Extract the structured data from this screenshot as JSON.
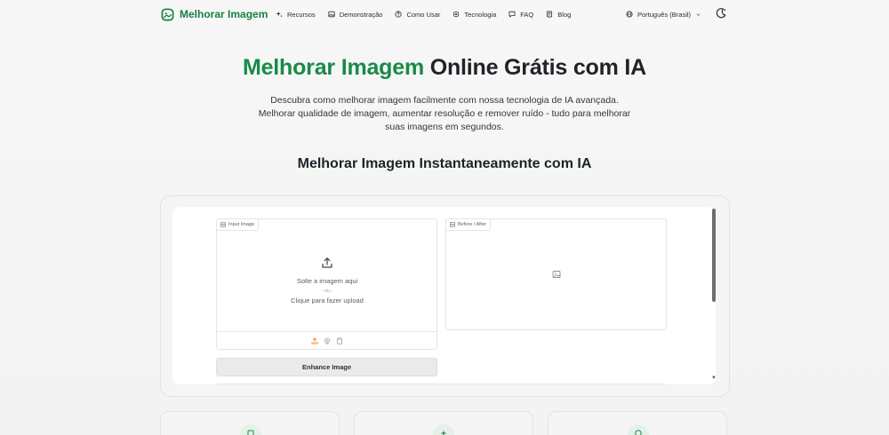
{
  "brand": {
    "name": "Melhorar Imagem",
    "color": "#1a7f43"
  },
  "nav": {
    "items": [
      {
        "label": "Recursos",
        "icon": "sparkles-icon"
      },
      {
        "label": "Demonstração",
        "icon": "image-icon"
      },
      {
        "label": "Como Usar",
        "icon": "help-circle-icon"
      },
      {
        "label": "Tecnologia",
        "icon": "chip-icon"
      },
      {
        "label": "FAQ",
        "icon": "message-question-icon"
      },
      {
        "label": "Blog",
        "icon": "book-icon"
      }
    ],
    "language": "Português (Brasil)"
  },
  "hero": {
    "title_highlight": "Melhorar Imagem",
    "title_rest": " Online Grátis com IA",
    "subtitle": "Descubra como melhorar imagem facilmente com nossa tecnologia de IA avançada. Melhorar qualidade de imagem, aumentar resolução e remover ruído - tudo para melhorar suas imagens em segundos."
  },
  "section": {
    "title": "Melhorar Imagem Instantaneamente com IA"
  },
  "app": {
    "input_panel": {
      "label": "Input Image",
      "drop_text": "Solte a imagem aqui",
      "or_text": "- ou -",
      "click_text": "Clique para fazer upload"
    },
    "output_panel": {
      "label": "Before / After"
    },
    "enhance_button": "Enhance Image"
  },
  "colors": {
    "accent": "#1a8a47",
    "upload_accent": "#f08a24"
  }
}
